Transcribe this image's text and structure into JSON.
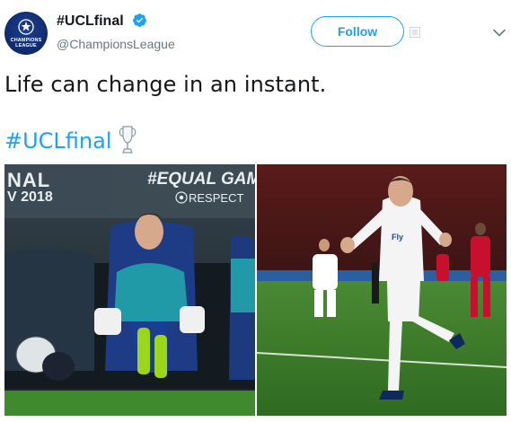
{
  "account": {
    "display_name": "#UCLfinal",
    "handle": "@ChampionsLeague",
    "avatar_text": "CHAMPIONS LEAGUE",
    "verified": true
  },
  "actions": {
    "follow_label": "Follow"
  },
  "tweet": {
    "text": "Life can change in an instant.",
    "hashtag": "#UCLfinal"
  },
  "media": {
    "left_photo": {
      "banner_left_line1": "NAL",
      "banner_left_line2": "V 2018",
      "banner_right_line1": "#EQUAL GAM",
      "banner_right_line2": "RESPECT"
    },
    "right_photo": {}
  },
  "colors": {
    "accent": "#1da1f2",
    "text": "#14171a",
    "secondary_text": "#657786"
  }
}
